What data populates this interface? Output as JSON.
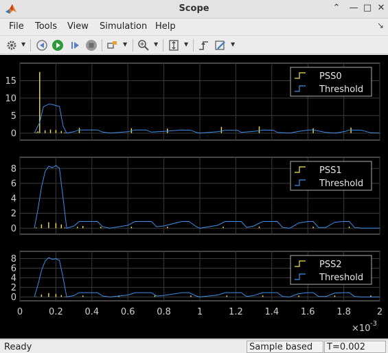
{
  "window": {
    "title": "Scope"
  },
  "menu": [
    "File",
    "Tools",
    "View",
    "Simulation",
    "Help"
  ],
  "status": {
    "state": "Ready",
    "mode": "Sample based",
    "time": "T=0.002"
  },
  "axes": {
    "x_ticks": [
      "0",
      "0.2",
      "0.4",
      "0.6",
      "0.8",
      "1",
      "1.2",
      "1.4",
      "1.6",
      "1.8",
      "2"
    ],
    "x_exponent": "×10",
    "x_exponent_power": "-3"
  },
  "colors": {
    "signal": "#f7e44a",
    "threshold": "#3d8fe8",
    "grid": "#3b3b3b",
    "background": "#000000",
    "plot_border": "#8a8a8a"
  },
  "chart_data": [
    {
      "type": "line",
      "legend": [
        "PSS0",
        "Threshold"
      ],
      "xlim": [
        0,
        0.002
      ],
      "ylim": [
        -2,
        20
      ],
      "y_ticks": [
        "0",
        "5",
        "10",
        "15"
      ],
      "series": [
        {
          "name": "PSS0",
          "x": [
            9e-05,
            0.0001,
            0.00011,
            0.00014,
            0.00017,
            0.0002,
            0.00023,
            0.00025,
            0.00033,
            0.00062,
            0.00082,
            0.00112,
            0.00133,
            0.00163,
            0.00184
          ],
          "y": [
            0.2,
            0.5,
            17.5,
            0.8,
            1.0,
            0.9,
            0.6,
            0.2,
            1.5,
            1.4,
            1.3,
            1.8,
            1.9,
            1.4,
            1.6
          ]
        },
        {
          "name": "Threshold",
          "x": [
            8e-05,
            0.00011,
            0.00013,
            0.00016,
            0.00018,
            0.0002,
            0.00022,
            0.00024,
            0.00026,
            0.0003,
            0.00033,
            0.00043,
            0.00046,
            0.0005,
            0.0006,
            0.00064,
            0.0007,
            0.00073,
            0.0008,
            0.0009,
            0.00095,
            0.00098,
            0.001,
            0.0011,
            0.00114,
            0.00121,
            0.00123,
            0.0013,
            0.00136,
            0.00141,
            0.00143,
            0.0015,
            0.00155,
            0.00161,
            0.00163,
            0.0017,
            0.00175,
            0.00181,
            0.00183,
            0.0019,
            0.00195,
            0.002
          ],
          "y": [
            0,
            3,
            7.5,
            8.3,
            8.2,
            7.9,
            7.6,
            2,
            0,
            0.4,
            0.9,
            0.9,
            0.3,
            0,
            0.4,
            0.9,
            0.9,
            0.3,
            0.5,
            0.9,
            0.8,
            0.2,
            0,
            0.4,
            0.8,
            0.8,
            0.2,
            0.5,
            0.9,
            0.8,
            0.2,
            0,
            0.5,
            0.9,
            0.9,
            0.2,
            0,
            0.5,
            0.9,
            0.8,
            0.1,
            0
          ]
        }
      ]
    },
    {
      "type": "line",
      "legend": [
        "PSS1",
        "Threshold"
      ],
      "xlim": [
        0,
        0.002
      ],
      "ylim": [
        -0.8,
        9.5
      ],
      "y_ticks": [
        "0",
        "2",
        "4",
        "6",
        "8"
      ],
      "series": [
        {
          "name": "PSS1",
          "x": [
            9e-05,
            0.00012,
            0.00016,
            0.0002,
            0.00023,
            0.00025,
            0.00032,
            0.00035,
            0.00045,
            0.00062,
            0.00082,
            0.00113,
            0.00133,
            0.00163,
            0.00183
          ],
          "y": [
            0.1,
            0.5,
            0.8,
            0.7,
            0.5,
            0.1,
            0.2,
            0.3,
            0.2,
            0.2,
            0.2,
            0.2,
            0.2,
            0.2,
            0.2
          ]
        },
        {
          "name": "Threshold",
          "x": [
            8e-05,
            0.0001,
            0.00012,
            0.00014,
            0.00016,
            0.00018,
            0.0002,
            0.00022,
            0.00024,
            0.00026,
            0.0003,
            0.00033,
            0.0004,
            0.00043,
            0.00046,
            0.0005,
            0.0006,
            0.00064,
            0.0007,
            0.00073,
            0.00076,
            0.0008,
            0.0009,
            0.00094,
            0.00098,
            0.001,
            0.0011,
            0.00114,
            0.0012,
            0.00123,
            0.00126,
            0.0013,
            0.00135,
            0.0014,
            0.00143,
            0.00146,
            0.0015,
            0.00155,
            0.0016,
            0.00163,
            0.00166,
            0.0017,
            0.00175,
            0.0018,
            0.00183,
            0.00186,
            0.0019,
            0.002
          ],
          "y": [
            0,
            2.5,
            5.5,
            7.6,
            8.3,
            8.1,
            8.4,
            8.0,
            4,
            0,
            0.3,
            0.9,
            0.9,
            0.9,
            0.2,
            0,
            0.4,
            0.9,
            0.9,
            0.9,
            0.2,
            0.3,
            0.9,
            0.9,
            0.2,
            0,
            0.4,
            0.9,
            0.9,
            0.9,
            0.1,
            0.3,
            0.9,
            0.9,
            0.9,
            0.1,
            0,
            0.7,
            0.9,
            0.9,
            0.1,
            0.1,
            0.8,
            0.9,
            0.9,
            0.1,
            0,
            0
          ]
        }
      ]
    },
    {
      "type": "line",
      "legend": [
        "PSS2",
        "Threshold"
      ],
      "xlim": [
        0,
        0.002
      ],
      "ylim": [
        -0.8,
        9.5
      ],
      "y_ticks": [
        "0",
        "2",
        "4",
        "6",
        "8"
      ],
      "series": [
        {
          "name": "PSS2",
          "x": [
            9e-05,
            0.00012,
            0.00016,
            0.0002,
            0.00023,
            0.00025,
            0.00035,
            0.00055,
            0.00075,
            0.00095,
            0.00115,
            0.00135,
            0.00155,
            0.00175,
            0.00195
          ],
          "y": [
            0.1,
            0.5,
            0.8,
            0.6,
            0.4,
            0.1,
            0.3,
            0.3,
            0.3,
            0.3,
            0.3,
            0.3,
            0.3,
            0.3,
            0.3
          ]
        },
        {
          "name": "Threshold",
          "x": [
            8e-05,
            0.0001,
            0.00012,
            0.00014,
            0.00016,
            0.00018,
            0.0002,
            0.00022,
            0.00024,
            0.00026,
            0.0003,
            0.00033,
            0.0004,
            0.00043,
            0.00046,
            0.0005,
            0.0006,
            0.00064,
            0.0007,
            0.00073,
            0.00076,
            0.0008,
            0.0009,
            0.00094,
            0.00098,
            0.001,
            0.0011,
            0.00114,
            0.0012,
            0.00123,
            0.00126,
            0.0013,
            0.00135,
            0.0014,
            0.00143,
            0.00146,
            0.0015,
            0.00155,
            0.0016,
            0.00163,
            0.00166,
            0.0017,
            0.00175,
            0.0018,
            0.00183,
            0.00186,
            0.0019,
            0.002
          ],
          "y": [
            0,
            2.5,
            5.5,
            7.5,
            8.2,
            7.8,
            8.0,
            7.6,
            4,
            0,
            0.3,
            0.9,
            0.9,
            0.9,
            0.2,
            0,
            0.4,
            0.9,
            0.9,
            0.9,
            0.2,
            0.3,
            0.9,
            0.9,
            0.2,
            0,
            0.4,
            0.9,
            0.9,
            0.9,
            0.1,
            0.3,
            0.9,
            0.9,
            0.9,
            0.1,
            0,
            0.7,
            0.9,
            0.9,
            0.1,
            0.1,
            0.8,
            0.9,
            0.9,
            0.1,
            0,
            0
          ]
        }
      ]
    }
  ]
}
